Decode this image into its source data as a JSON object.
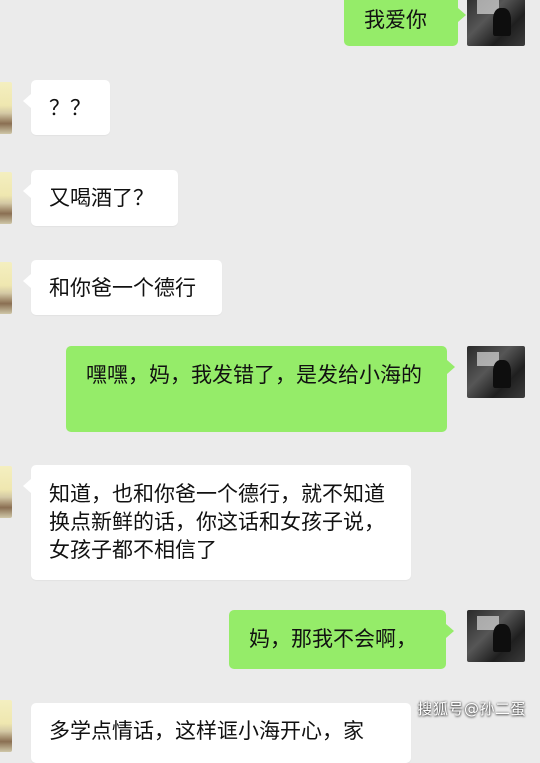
{
  "colors": {
    "background": "#ebebeb",
    "outgoing_bubble": "#95ec69",
    "incoming_bubble": "#ffffff",
    "text": "#111111"
  },
  "messages": [
    {
      "sender": "me",
      "text": "我爱你"
    },
    {
      "sender": "mom",
      "text": "？？"
    },
    {
      "sender": "mom",
      "text": "又喝酒了？"
    },
    {
      "sender": "mom",
      "text": "和你爸一个德行"
    },
    {
      "sender": "me",
      "text": "嘿嘿，妈，我发错了，是发给小海的"
    },
    {
      "sender": "mom",
      "text": "知道，也和你爸一个德行，就不知道换点新鲜的话，你这话和女孩子说，女孩子都不相信了"
    },
    {
      "sender": "me",
      "text": "妈，那我不会啊，"
    },
    {
      "sender": "mom",
      "text": "多学点情话，这样诓小海开心，家"
    }
  ],
  "watermark": "搜狐号@孙二蛋"
}
